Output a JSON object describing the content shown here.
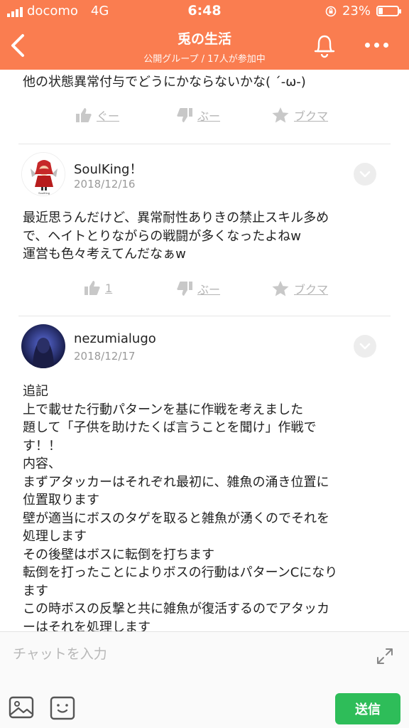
{
  "status_bar": {
    "carrier": "docomo",
    "network": "4G",
    "time": "6:48",
    "battery": "23%",
    "battery_level": 0.23
  },
  "header": {
    "title": "兎の生活",
    "subtitle": "公開グループ / 17人が参加中"
  },
  "posts": [
    {
      "text": "他の状態異常付与でどうにかならないかな( ´-ω-)",
      "actions": {
        "like": "ぐー",
        "dislike": "ぶー",
        "bookmark": "ブクマ"
      }
    },
    {
      "user": "SoulKing！",
      "date": "2018/12/16",
      "avatar_caption": "SoulKing",
      "lines": [
        "最近思うんだけど、異常耐性ありきの禁止スキル多め",
        "で、ヘイトとりながらの戦闘が多くなったよねw",
        "運営も色々考えてんだなぁw"
      ],
      "actions": {
        "like": "1",
        "dislike": "ぶー",
        "bookmark": "ブクマ"
      }
    },
    {
      "user": "nezumialugo",
      "date": "2018/12/17",
      "lines": [
        "追記",
        "上で載せた行動パターンを基に作戦を考えました",
        "題して「子供を助けたくば言うことを聞け」作戦で",
        "す！！",
        "内容、",
        "まずアタッカーはそれぞれ最初に、雑魚の涌き位置に",
        "位置取ります",
        "壁が適当にボスのタゲを取ると雑魚が湧くのでそれを",
        "処理します",
        "その後壁はボスに転倒を打ちます",
        "転倒を打ったことによりボスの行動はパターンCになり",
        "ます",
        "この時ボスの反撃と共に雑魚が復活するのでアタッカ",
        "ーはそれを処理します"
      ]
    }
  ],
  "chat": {
    "placeholder": "チャットを入力",
    "send": "送信"
  },
  "colors": {
    "brand": "#fa7d50",
    "send": "#2ebd59"
  }
}
